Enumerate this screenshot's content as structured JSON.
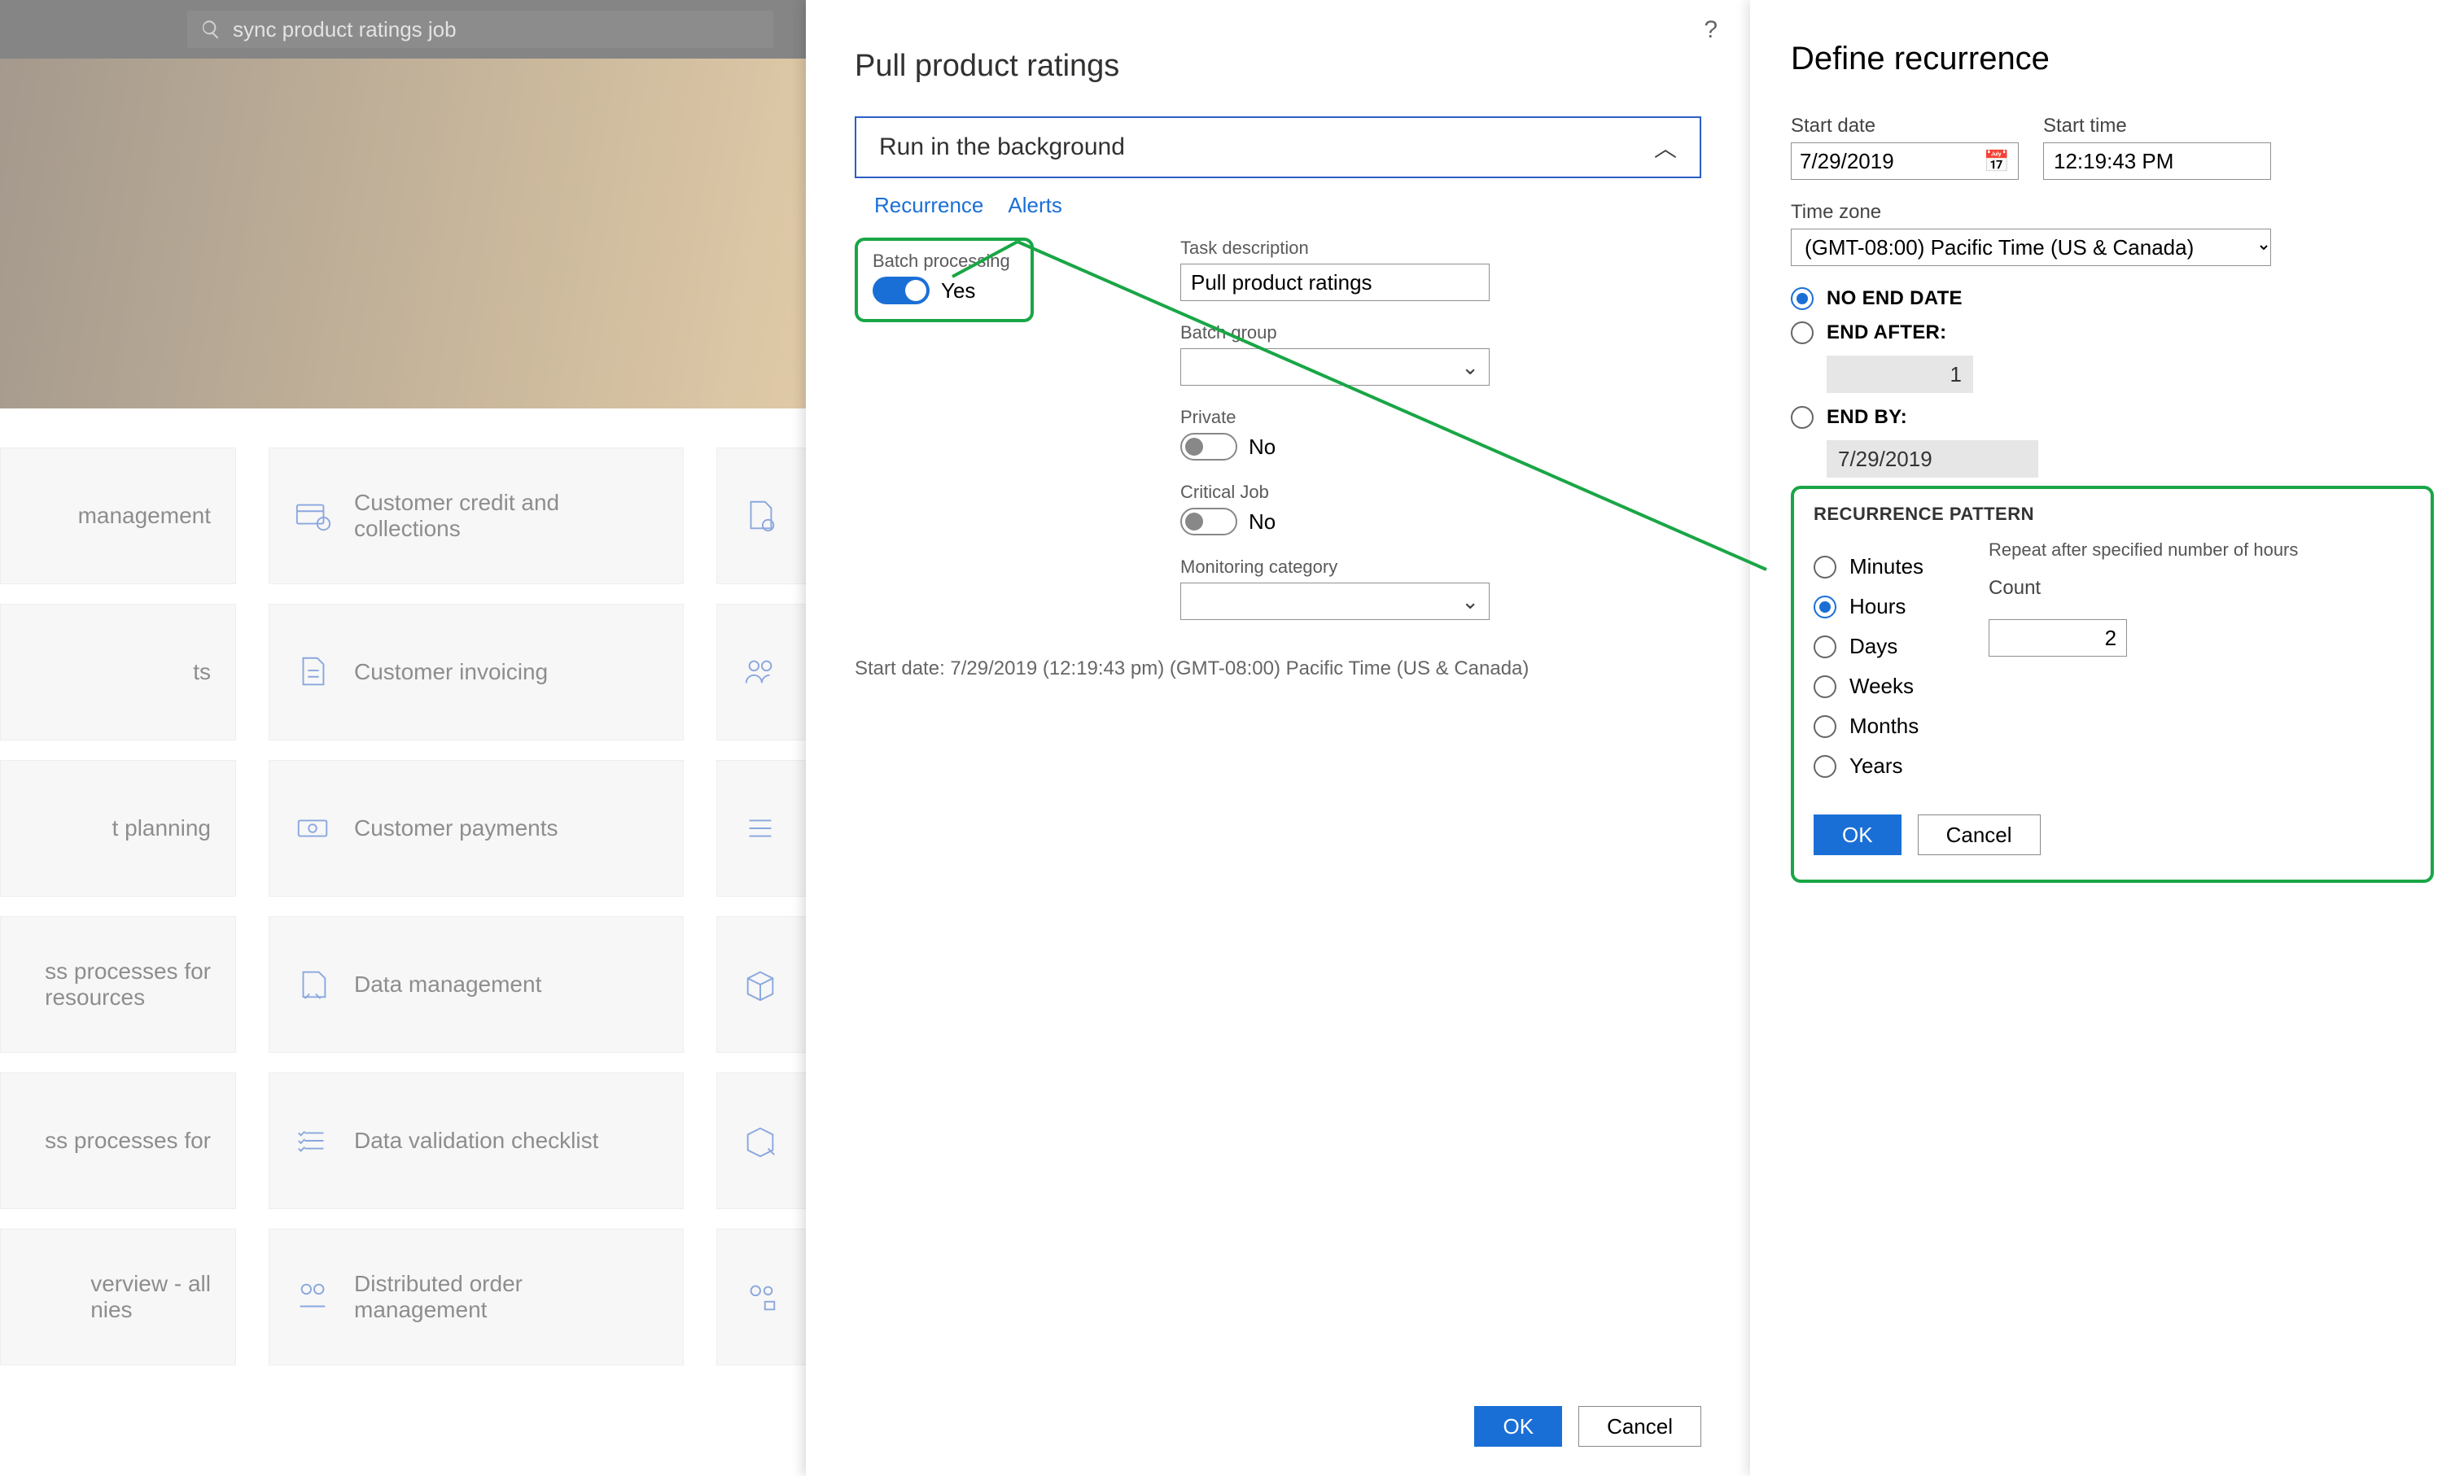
{
  "search": {
    "placeholder": "sync product ratings job"
  },
  "tiles": {
    "col1": [
      "management",
      "ts",
      "t planning",
      "ss processes for\nresources",
      "ss processes for",
      "verview - all\nnies"
    ],
    "col2": [
      "Customer credit and collections",
      "Customer invoicing",
      "Customer payments",
      "Data management",
      "Data validation checklist",
      "Distributed order management"
    ]
  },
  "panel1": {
    "title": "Pull product ratings",
    "section": "Run in the background",
    "links": {
      "recurrence": "Recurrence",
      "alerts": "Alerts"
    },
    "batch": {
      "label": "Batch processing",
      "value": "Yes"
    },
    "task": {
      "label": "Task description",
      "value": "Pull product ratings"
    },
    "batch_group": {
      "label": "Batch group",
      "value": ""
    },
    "private": {
      "label": "Private",
      "value": "No"
    },
    "critical": {
      "label": "Critical Job",
      "value": "No"
    },
    "monitoring": {
      "label": "Monitoring category",
      "value": ""
    },
    "start_line": "Start date: 7/29/2019 (12:19:43 pm) (GMT-08:00) Pacific Time (US & Canada)",
    "ok": "OK",
    "cancel": "Cancel"
  },
  "panel2": {
    "title": "Define recurrence",
    "start_date": {
      "label": "Start date",
      "value": "7/29/2019"
    },
    "start_time": {
      "label": "Start time",
      "value": "12:19:43 PM"
    },
    "tz": {
      "label": "Time zone",
      "value": "(GMT-08:00) Pacific Time (US & Canada)"
    },
    "end": {
      "no_end": "NO END DATE",
      "end_after": "END AFTER:",
      "end_after_val": "1",
      "end_by": "END BY:",
      "end_by_val": "7/29/2019",
      "selected": "no_end"
    },
    "pattern": {
      "header": "RECURRENCE PATTERN",
      "hint": "Repeat after specified number of hours",
      "options": [
        "Minutes",
        "Hours",
        "Days",
        "Weeks",
        "Months",
        "Years"
      ],
      "selected": "Hours",
      "count_label": "Count",
      "count": "2"
    },
    "ok": "OK",
    "cancel": "Cancel"
  }
}
